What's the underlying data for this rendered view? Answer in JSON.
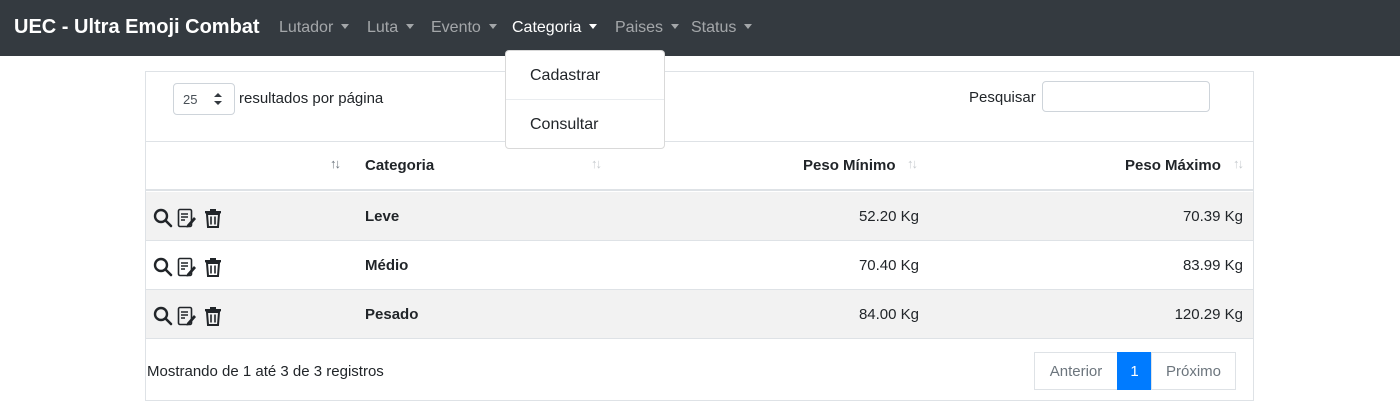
{
  "navbar": {
    "brand": "UEC - Ultra Emoji Combat",
    "items": [
      {
        "label": "Lutador"
      },
      {
        "label": "Luta"
      },
      {
        "label": "Evento"
      },
      {
        "label": "Categoria"
      },
      {
        "label": "Paises"
      },
      {
        "label": "Status"
      }
    ],
    "active_item": "Categoria",
    "dropdown": {
      "items": [
        {
          "label": "Cadastrar"
        },
        {
          "label": "Consultar"
        }
      ]
    }
  },
  "table_controls": {
    "page_length": "25",
    "page_length_label": "resultados por página",
    "search_label": "Pesquisar",
    "search_value": ""
  },
  "table": {
    "columns": [
      "",
      "Categoria",
      "Peso Mínimo",
      "Peso Máximo"
    ],
    "rows": [
      {
        "categoria": "Leve",
        "peso_minimo": "52.20 Kg",
        "peso_maximo": "70.39 Kg"
      },
      {
        "categoria": "Médio",
        "peso_minimo": "70.40 Kg",
        "peso_maximo": "83.99 Kg"
      },
      {
        "categoria": "Pesado",
        "peso_minimo": "84.00 Kg",
        "peso_maximo": "120.29 Kg"
      }
    ],
    "row_actions": [
      "search-icon",
      "edit-icon",
      "trash-icon"
    ]
  },
  "footer": {
    "info": "Mostrando de 1 até 3 de 3 registros",
    "pagination": {
      "previous": "Anterior",
      "current_page": "1",
      "next": "Próximo"
    }
  },
  "colors": {
    "navbar_bg": "#343a40",
    "accent": "#007bff",
    "striped_row": "#f2f2f2"
  }
}
